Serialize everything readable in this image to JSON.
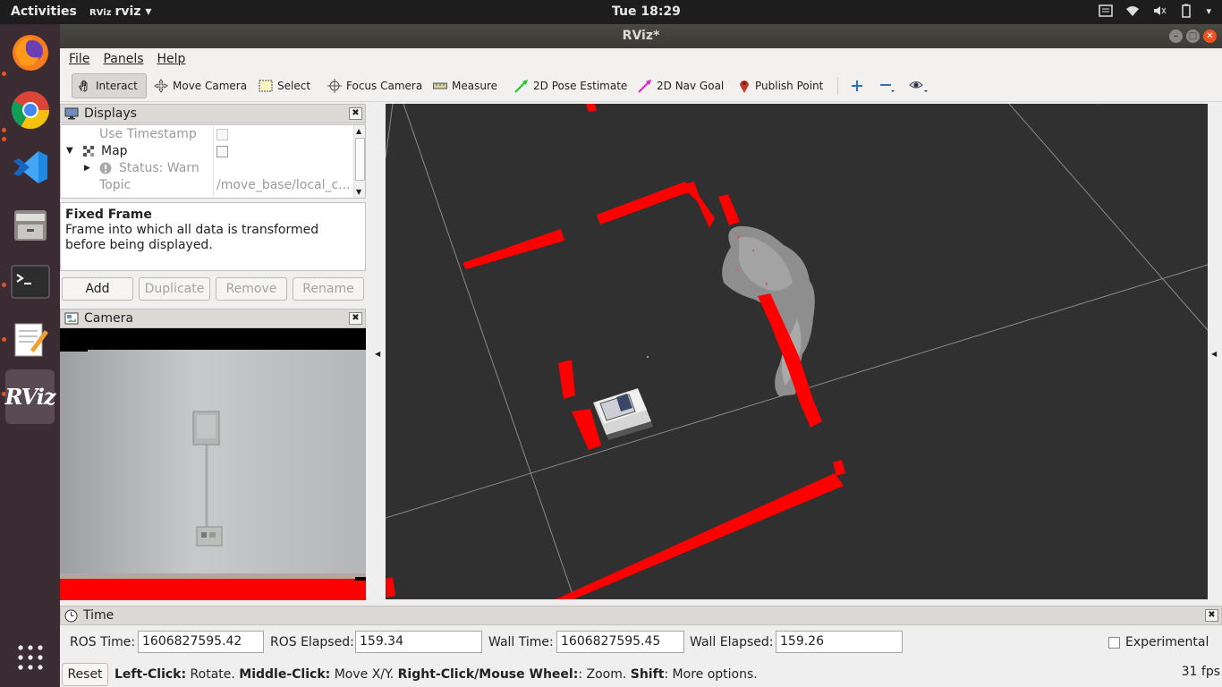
{
  "topbar": {
    "activities": "Activities",
    "app_icon_text": "RViz",
    "app_name": "rviz",
    "clock": "Tue 18:29"
  },
  "dock": {
    "items": [
      "firefox-icon",
      "chrome-icon",
      "vscode-icon",
      "files-icon",
      "terminal-icon",
      "text-editor-icon",
      "rviz-icon",
      "show-apps-icon"
    ],
    "rviz_label": "RViz"
  },
  "window": {
    "title": "RViz*"
  },
  "menubar": {
    "file": "File",
    "panels": "Panels",
    "help": "Help"
  },
  "toolbar": {
    "interact": "Interact",
    "move_camera": "Move Camera",
    "select": "Select",
    "focus_camera": "Focus Camera",
    "measure": "Measure",
    "pose_estimate": "2D Pose Estimate",
    "nav_goal": "2D Nav Goal",
    "publish_point": "Publish Point"
  },
  "displays": {
    "title": "Displays",
    "rows": {
      "use_timestamp": "Use Timestamp",
      "map": "Map",
      "status": "Status: Warn",
      "topic": "Topic",
      "topic_value": "/move_base/local_c..."
    },
    "description_title": "Fixed Frame",
    "description_text": "Frame into which all data is transformed before being displayed.",
    "buttons": {
      "add": "Add",
      "duplicate": "Duplicate",
      "remove": "Remove",
      "rename": "Rename"
    }
  },
  "camera": {
    "title": "Camera"
  },
  "time": {
    "title": "Time",
    "ros_time_label": "ROS Time:",
    "ros_time": "1606827595.42",
    "ros_elapsed_label": "ROS Elapsed:",
    "ros_elapsed": "159.34",
    "wall_time_label": "Wall Time:",
    "wall_time": "1606827595.45",
    "wall_elapsed_label": "Wall Elapsed:",
    "wall_elapsed": "159.26",
    "experimental": "Experimental"
  },
  "statusbar": {
    "reset": "Reset",
    "left_click_bold": "Left-Click:",
    "left_click": " Rotate. ",
    "middle_click_bold": "Middle-Click:",
    "middle_click": " Move X/Y. ",
    "right_click_bold": "Right-Click/Mouse Wheel:",
    "right_click": ": Zoom. ",
    "shift_bold": "Shift",
    "shift": ": More options.",
    "fps": "31 fps"
  },
  "colors": {
    "ubuntu_orange": "#e95420",
    "laser_red": "#ff0000",
    "view_bg": "#303030"
  }
}
